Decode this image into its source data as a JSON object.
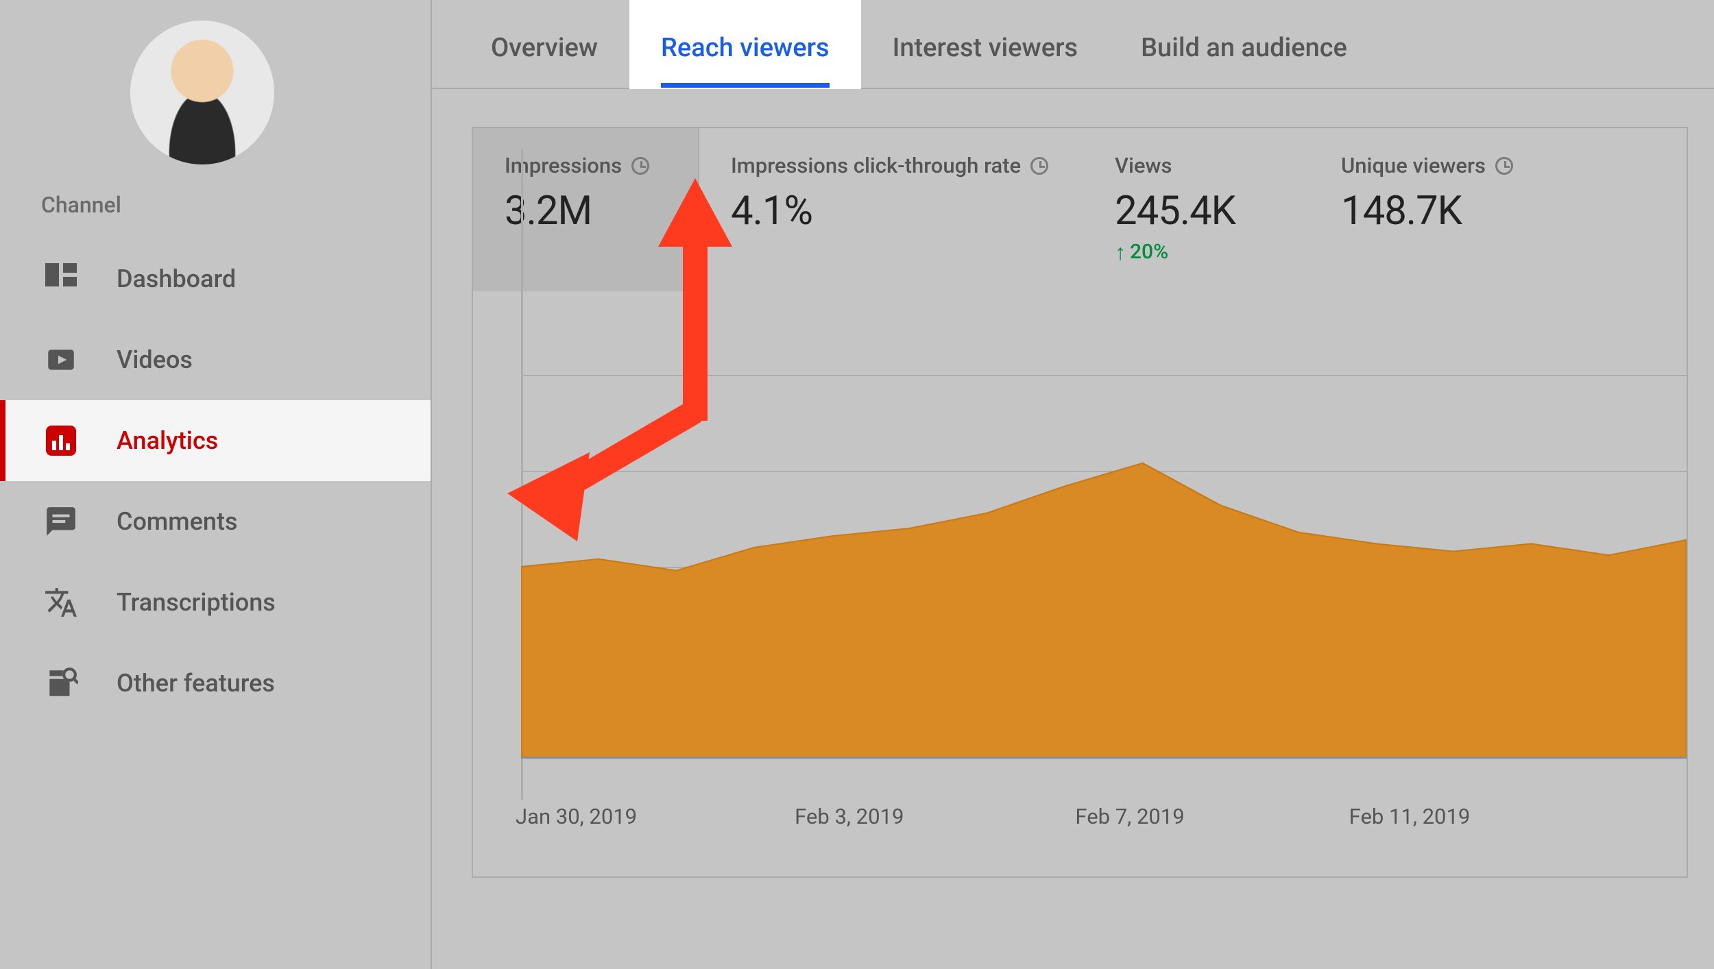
{
  "sidebar": {
    "section_label": "Channel",
    "items": [
      {
        "id": "dashboard",
        "label": "Dashboard"
      },
      {
        "id": "videos",
        "label": "Videos"
      },
      {
        "id": "analytics",
        "label": "Analytics"
      },
      {
        "id": "comments",
        "label": "Comments"
      },
      {
        "id": "transcriptions",
        "label": "Transcriptions"
      },
      {
        "id": "other",
        "label": "Other features"
      }
    ],
    "active_id": "analytics"
  },
  "tabs": {
    "items": [
      {
        "id": "overview",
        "label": "Overview"
      },
      {
        "id": "reach",
        "label": "Reach viewers"
      },
      {
        "id": "interest",
        "label": "Interest viewers"
      },
      {
        "id": "audience",
        "label": "Build an audience"
      }
    ],
    "active_id": "reach"
  },
  "metrics": {
    "impressions": {
      "label": "Impressions",
      "value": "3.2M"
    },
    "ctr": {
      "label": "Impressions click-through rate",
      "value": "4.1%"
    },
    "views": {
      "label": "Views",
      "value": "245.4K",
      "delta": "20%"
    },
    "unique": {
      "label": "Unique viewers",
      "value": "148.7K"
    },
    "selected_id": "impressions"
  },
  "chart_data": {
    "type": "area",
    "title": "",
    "ylabel": "",
    "xlabel": "",
    "ylim": [
      0,
      100
    ],
    "x_tick_labels": [
      "Jan 30, 2019",
      "Feb 3, 2019",
      "Feb 7, 2019",
      "Feb 11, 2019"
    ],
    "x": [
      0,
      1,
      2,
      3,
      4,
      5,
      6,
      7,
      8,
      9,
      10,
      11,
      12,
      13,
      14,
      15
    ],
    "values_relative": [
      50,
      52,
      49,
      55,
      58,
      60,
      64,
      71,
      77,
      66,
      59,
      56,
      54,
      56,
      53,
      57
    ],
    "note": "values_relative are estimated % of plot height; no y-axis labels visible"
  },
  "annotation": {
    "color": "#ff3b1f",
    "description": "Arrow pointing from chart start up to the Reach viewers tab"
  }
}
